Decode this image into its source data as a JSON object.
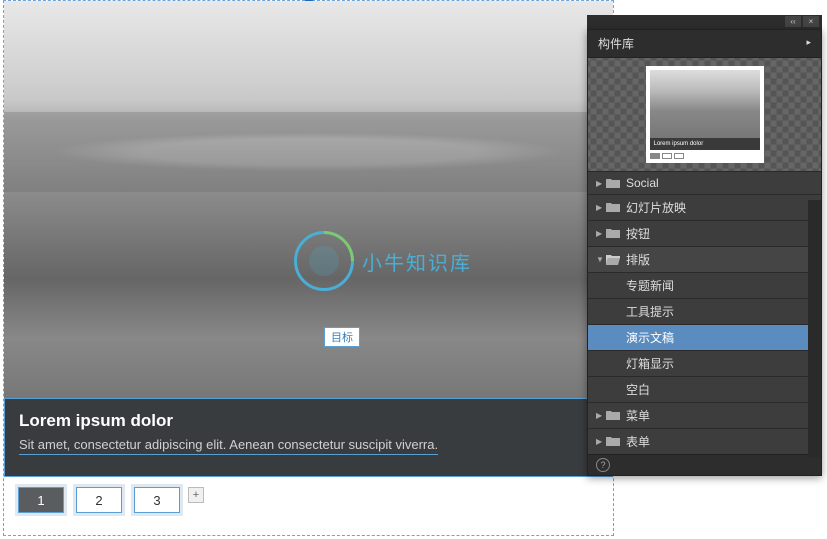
{
  "slide": {
    "watermark_text": "小牛知识库",
    "target_label": "目标",
    "caption_title": "Lorem ipsum dolor",
    "caption_text": "Sit amet, consectetur adipiscing elit. Aenean consectetur suscipit viverra."
  },
  "pager": {
    "pages": [
      "1",
      "2",
      "3"
    ],
    "active_index": 0,
    "add_label": "+"
  },
  "panel": {
    "title": "构件库",
    "preview_caption_title": "Lorem ipsum dolor",
    "categories": [
      {
        "label": "Social",
        "expanded": false
      },
      {
        "label": "幻灯片放映",
        "expanded": false
      },
      {
        "label": "按钮",
        "expanded": false
      },
      {
        "label": "排版",
        "expanded": true,
        "children": [
          "专题新闻",
          "工具提示",
          "演示文稿",
          "灯箱显示",
          "空白"
        ],
        "selected_index": 2
      },
      {
        "label": "菜单",
        "expanded": false
      },
      {
        "label": "表单",
        "expanded": false
      }
    ],
    "help_label": "?"
  }
}
